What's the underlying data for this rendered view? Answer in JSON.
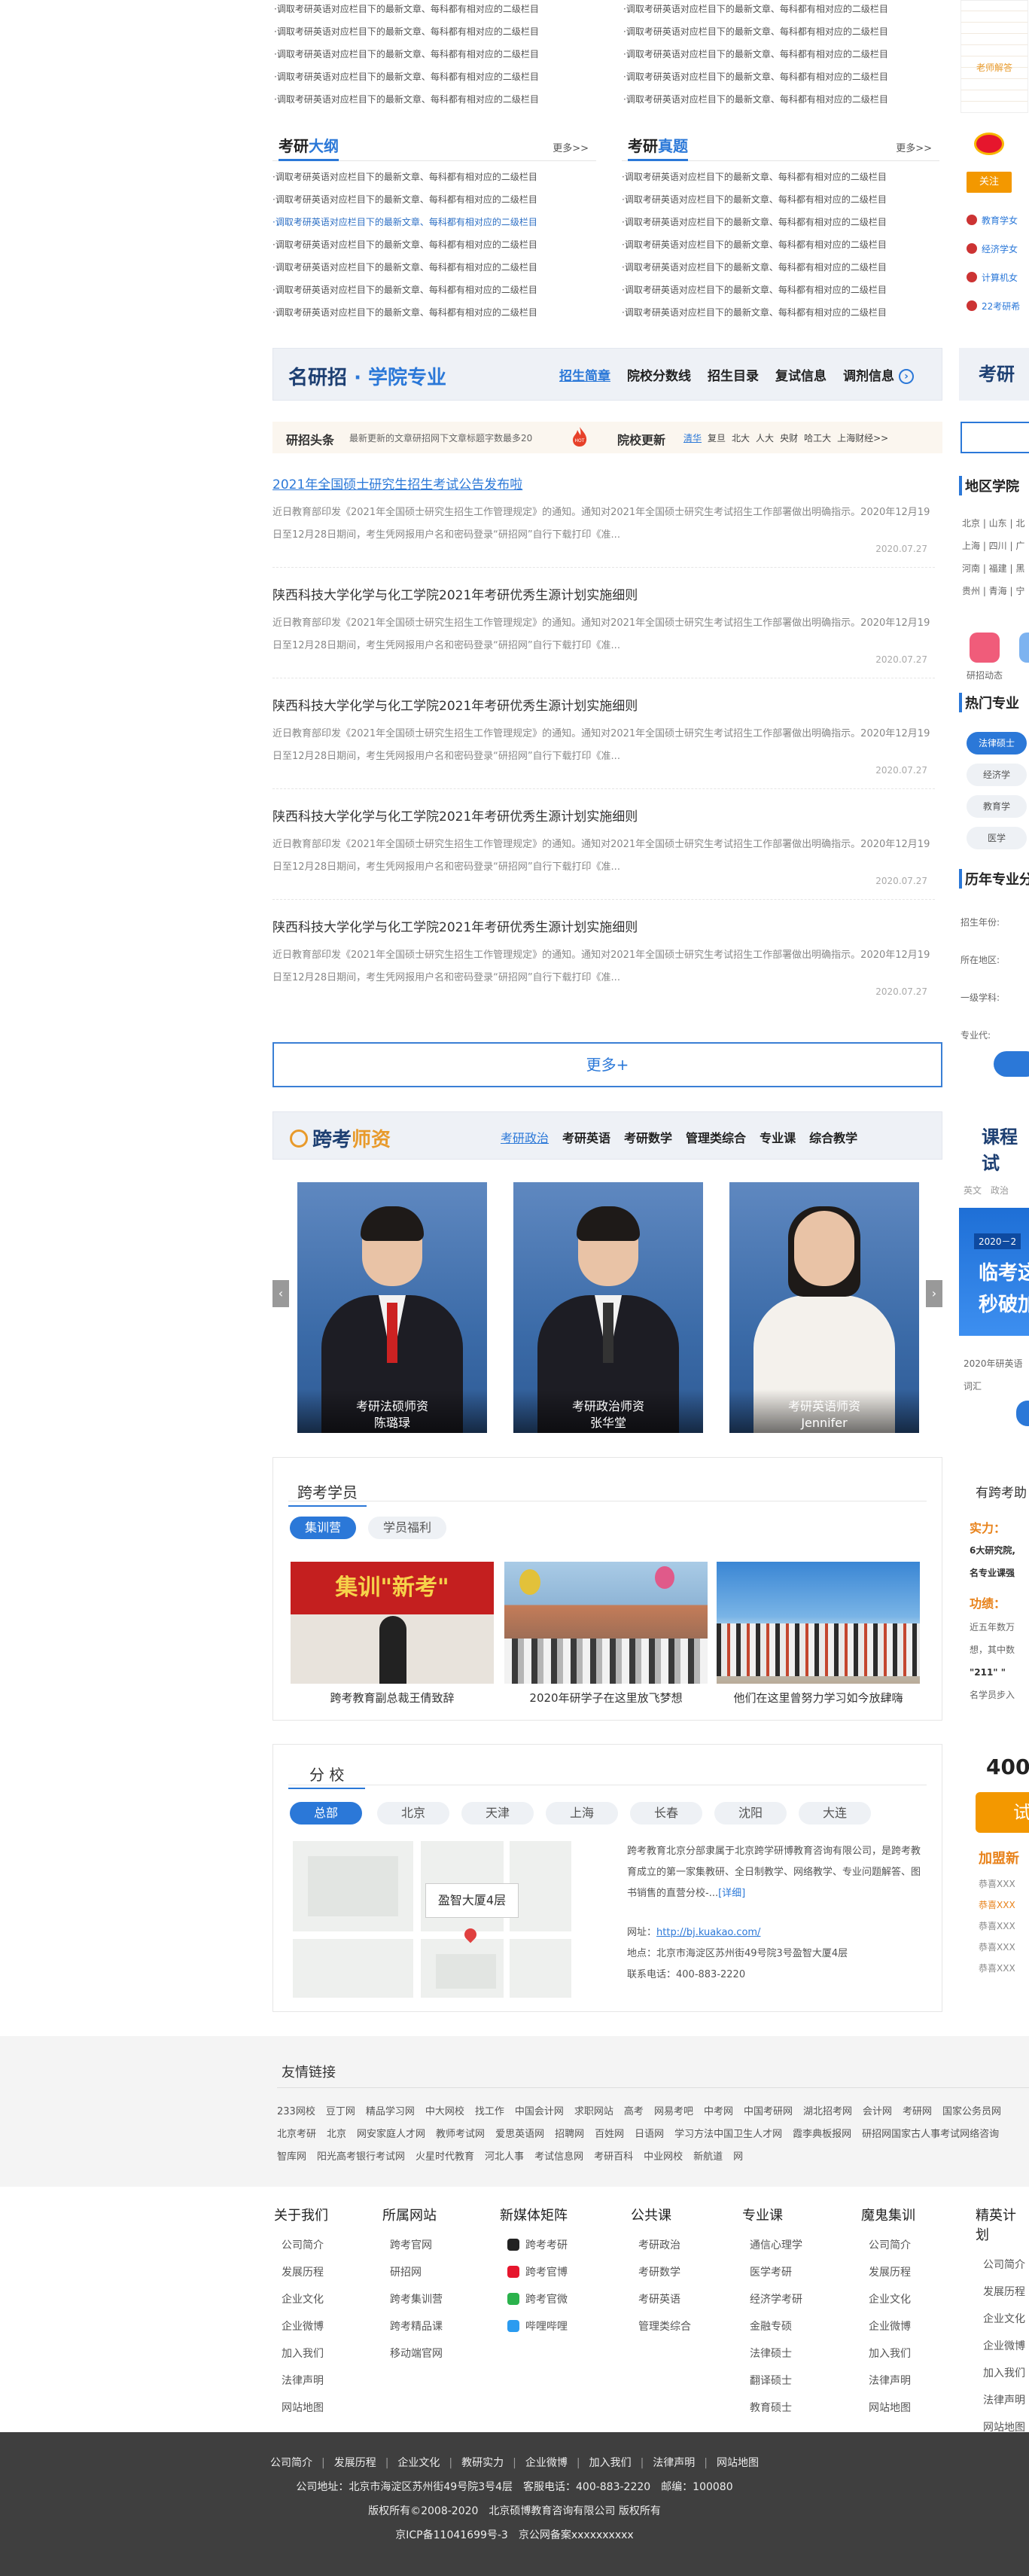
{
  "colors": {
    "accent": "#2b78d8",
    "hot": "#e7412a",
    "dark_footer": "#3f3f3f",
    "weibo_button": "#f39800"
  },
  "news_placeholder": "·调取考研英语对应栏目下的最新文章、每科都有相对应的二级栏目",
  "top_list": {
    "left": [
      "·调取考研英语对应栏目下的最新文章、每科都有相对应的二级栏目",
      "·调取考研英语对应栏目下的最新文章、每科都有相对应的二级栏目",
      "·调取考研英语对应栏目下的最新文章、每科都有相对应的二级栏目",
      "·调取考研英语对应栏目下的最新文章、每科都有相对应的二级栏目",
      "·调取考研英语对应栏目下的最新文章、每科都有相对应的二级栏目"
    ],
    "right": [
      "·调取考研英语对应栏目下的最新文章、每科都有相对应的二级栏目",
      "·调取考研英语对应栏目下的最新文章、每科都有相对应的二级栏目",
      "·调取考研英语对应栏目下的最新文章、每科都有相对应的二级栏目",
      "·调取考研英语对应栏目下的最新文章、每科都有相对应的二级栏目",
      "·调取考研英语对应栏目下的最新文章、每科都有相对应的二级栏目"
    ]
  },
  "outline": {
    "title_a": "考研",
    "title_b": "大纲",
    "more": "更多>>",
    "items": [
      "·调取考研英语对应栏目下的最新文章、每科都有相对应的二级栏目",
      "·调取考研英语对应栏目下的最新文章、每科都有相对应的二级栏目",
      "·调取考研英语对应栏目下的最新文章、每科都有相对应的二级栏目",
      "·调取考研英语对应栏目下的最新文章、每科都有相对应的二级栏目",
      "·调取考研英语对应栏目下的最新文章、每科都有相对应的二级栏目",
      "·调取考研英语对应栏目下的最新文章、每科都有相对应的二级栏目",
      "·调取考研英语对应栏目下的最新文章、每科都有相对应的二级栏目"
    ]
  },
  "real_exam": {
    "title_a": "考研",
    "title_b": "真题",
    "more": "更多>>",
    "items": [
      "·调取考研英语对应栏目下的最新文章、每科都有相对应的二级栏目",
      "·调取考研英语对应栏目下的最新文章、每科都有相对应的二级栏目",
      "·调取考研英语对应栏目下的最新文章、每科都有相对应的二级栏目",
      "·调取考研英语对应栏目下的最新文章、每科都有相对应的二级栏目",
      "·调取考研英语对应栏目下的最新文章、每科都有相对应的二级栏目",
      "·调取考研英语对应栏目下的最新文章、每科都有相对应的二级栏目",
      "·调取考研英语对应栏目下的最新文章、每科都有相对应的二级栏目"
    ]
  },
  "admissions": {
    "logo_a": "名研招",
    "logo_b": "学院专业",
    "nav": [
      "招生简章",
      "院校分数线",
      "招生目录",
      "复试信息",
      "调剂信息"
    ]
  },
  "headline": {
    "label": "研招头条",
    "text": "最新更新的文章研招网下文章标题字数最多20",
    "hot": "HOT",
    "update_label": "院校更新",
    "schools": [
      "清华",
      "复旦",
      "北大",
      "人大",
      "央财",
      "哈工大",
      "上海财经>>"
    ]
  },
  "articles": [
    {
      "title": "2021年全国硕士研究生招生考试公告发布啦",
      "summary": "近日教育部印发《2021年全国硕士研究生招生工作管理规定》的通知。通知对2021年全国硕士研究生考试招生工作部署做出明确指示。2020年12月19日至12月28日期间，考生凭网报用户名和密码登录“研招网”自行下载打印《准...",
      "date": "2020.07.27"
    },
    {
      "title": "陕西科技大学化学与化工学院2021年考研优秀生源计划实施细则",
      "summary": "近日教育部印发《2021年全国硕士研究生招生工作管理规定》的通知。通知对2021年全国硕士研究生考试招生工作部署做出明确指示。2020年12月19日至12月28日期间，考生凭网报用户名和密码登录“研招网”自行下载打印《准...",
      "date": "2020.07.27"
    },
    {
      "title": "陕西科技大学化学与化工学院2021年考研优秀生源计划实施细则",
      "summary": "近日教育部印发《2021年全国硕士研究生招生工作管理规定》的通知。通知对2021年全国硕士研究生考试招生工作部署做出明确指示。2020年12月19日至12月28日期间，考生凭网报用户名和密码登录“研招网”自行下载打印《准...",
      "date": "2020.07.27"
    },
    {
      "title": "陕西科技大学化学与化工学院2021年考研优秀生源计划实施细则",
      "summary": "近日教育部印发《2021年全国硕士研究生招生工作管理规定》的通知。通知对2021年全国硕士研究生考试招生工作部署做出明确指示。2020年12月19日至12月28日期间，考生凭网报用户名和密码登录“研招网”自行下载打印《准...",
      "date": "2020.07.27"
    },
    {
      "title": "陕西科技大学化学与化工学院2021年考研优秀生源计划实施细则",
      "summary": "近日教育部印发《2021年全国硕士研究生招生工作管理规定》的通知。通知对2021年全国硕士研究生考试招生工作部署做出明确指示。2020年12月19日至12月28日期间，考生凭网报用户名和密码登录“研招网”自行下载打印《准...",
      "date": "2020.07.27"
    }
  ],
  "more_button": "更多+",
  "teachers": {
    "logo_a": "跨考",
    "logo_b": "师资",
    "nav": [
      "考研政治",
      "考研英语",
      "考研数学",
      "管理类综合",
      "专业课",
      "综合教学"
    ],
    "cards": [
      {
        "role": "考研法硕师资",
        "name": "陈璐琭"
      },
      {
        "role": "考研政治师资",
        "name": "张华堂"
      },
      {
        "role": "考研英语师资",
        "name": "Jennifer"
      }
    ],
    "prev": "‹",
    "next": "›"
  },
  "students": {
    "title": "跨考学员",
    "tabs": [
      "集训营",
      "学员福利"
    ],
    "photos": [
      {
        "caption": "跨考教育副总裁王倩致辞",
        "banner": "集训\"新考\""
      },
      {
        "caption": "2020年研学子在这里放飞梦想"
      },
      {
        "caption": "他们在这里曾努力学习如今放肆嗨"
      }
    ]
  },
  "branches": {
    "title": "分 校",
    "tabs": [
      "总部",
      "北京",
      "天津",
      "上海",
      "长春",
      "沈阳",
      "大连"
    ],
    "map_label": "盈智大厦4层",
    "intro": "跨考教育北京分部隶属于北京跨学研博教育咨询有限公司，是跨考教育成立的第一家集教研、全日制教学、网络教学、专业问题解答、图书销售的直营分校-...",
    "detail": "[详细]",
    "site_label": "网址：",
    "site": "http://bj.kuakao.com/",
    "address": "地点：北京市海淀区苏州街49号院3号盈智大厦4层",
    "phone": "联系电话：400-883-2220"
  },
  "friend": {
    "title": "友情链接",
    "links": [
      "233网校",
      "豆丁网",
      "精品学习网",
      "中大网校",
      "找工作",
      "中国会计网",
      "求职网站",
      "高考",
      "网易考吧",
      "中考网",
      "中国考研网",
      "湖北招考网",
      "会计网",
      "考研网",
      "国家公务员网",
      "北京考研",
      "北京",
      "网安家庭人才网",
      "教师考试网",
      "爱思英语网",
      "招聘网",
      "百姓网",
      "日语网",
      "学习方法中国卫生人才网",
      "霞李典板报网",
      "研招网国家古人事考试网络咨询",
      "智库网",
      "阳光高考银行考试网",
      "火星时代教育",
      "河北人事",
      "考试信息网",
      "考研百科",
      "中业网校",
      "新航道",
      "网"
    ]
  },
  "footer_cols": [
    {
      "title": "关于我们",
      "items": [
        "公司简介",
        "发展历程",
        "企业文化",
        "企业微博",
        "加入我们",
        "法律声明",
        "网站地图"
      ]
    },
    {
      "title": "所属网站",
      "items": [
        "跨考官网",
        "研招网",
        "跨考集训营",
        "跨考精品课",
        "移动端官网"
      ]
    },
    {
      "title": "新媒体矩阵",
      "items": [
        "跨考考研",
        "跨考官博",
        "跨考官微",
        "哔哩哔哩"
      ]
    },
    {
      "title": "公共课",
      "items": [
        "考研政治",
        "考研数学",
        "考研英语",
        "管理类综合"
      ]
    },
    {
      "title": "专业课",
      "items": [
        "通信心理学",
        "医学考研",
        "经济学考研",
        "金融专硕",
        "法律硕士",
        "翻译硕士",
        "教育硕士"
      ]
    },
    {
      "title": "魔鬼集训",
      "items": [
        "公司简介",
        "发展历程",
        "企业文化",
        "企业微博",
        "加入我们",
        "法律声明",
        "网站地图"
      ]
    },
    {
      "title": "精英计划",
      "items": [
        "公司简介",
        "发展历程",
        "企业文化",
        "企业微博",
        "加入我们",
        "法律声明",
        "网站地图"
      ]
    }
  ],
  "bottom": {
    "links": [
      "公司简介",
      "发展历程",
      "企业文化",
      "教研实力",
      "企业微博",
      "加入我们",
      "法律声明",
      "网站地图"
    ],
    "address": "公司地址：北京市海淀区苏州街49号院3号4层　客服电话：400-883-2220　邮编：100080",
    "copyright": "版权所有©2008-2020　北京硕博教育咨询有限公司 版权所有",
    "icp": "京ICP备11041699号-3　京公网备案xxxxxxxxxx"
  },
  "sidebar": {
    "teacher_btn": "老师解答",
    "follow": "关注",
    "weibo_items": [
      "教育学女",
      "经济学女",
      "计算机女",
      "22考研希"
    ],
    "kaoyan": "考研",
    "region_title": "地区学院",
    "regions": [
      "北京 | 山东 | 北",
      "上海 | 四川 | 广",
      "河南 | 福建 | 黑",
      "贵州 | 青海 | 宁"
    ],
    "region_icon_label": "研招动态",
    "hot_major_title": "热门专业",
    "hot_majors": [
      "法律硕士",
      "经济学",
      "教育学",
      "医学"
    ],
    "history_title": "历年专业分",
    "form": [
      "招生年份:",
      "所在地区:",
      "一级学科:",
      "专业代:"
    ],
    "course_title": "课程试",
    "course_tabs": "英文　政治",
    "promo_year": "2020－2",
    "promo_l1": "临考这",
    "promo_l2": "秒破加",
    "promo_desc1": "2020年研英语",
    "promo_desc2": "词汇",
    "kaokao_title": "有跨考助",
    "strength_lbl": "实力：",
    "strength1": "6大研究院,",
    "strength2": "名专业课强",
    "effect_lbl": "功绩：",
    "effect1": "近五年数万",
    "effect2": "想，其中数",
    "effect3": "\"211\" \"",
    "effect4": "名学员步入",
    "phone_short": "400",
    "apply_btn": "试",
    "join_title": "加盟新",
    "join_items": [
      "恭喜XXX",
      "恭喜XXX",
      "恭喜XXX",
      "恭喜XXX",
      "恭喜XXX"
    ]
  }
}
